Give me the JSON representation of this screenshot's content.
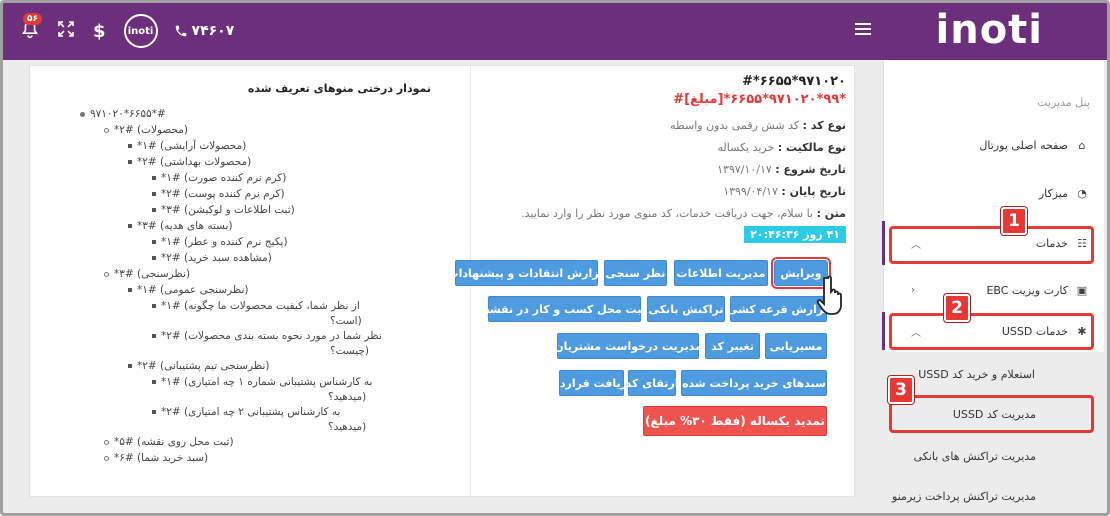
{
  "topbar": {
    "logo": "inoti",
    "badge": "۵۶",
    "currency": "$",
    "small_logo": "inoti",
    "phone": "۷۴۶۰۷"
  },
  "tree": {
    "title": "نمودار درختی منوهای تعریف شده",
    "rows": [
      "#*۶۶۵۵*۹۷۱۰۲۰",
      "(محصولات) #۲*",
      "(محصولات آرایشی) #۱*",
      "(محصولات بهداشتی) #۲*",
      "(کرم نرم کننده صورت) #۱*",
      "(کرم نرم کننده پوست) #۲*",
      "(ثبت اطلاعات و لوکیشن) #۳*",
      "(بسته های هدیه) #۳*",
      "(پکیج نرم کننده و عطر) #۱*",
      "(مشاهده سبد خرید) #۲*",
      "(نظرسنجی) #۳*",
      "(نظرسنجی عمومی) #۱*",
      "از نظر شما، کیفیت محصولات ما چگونه) #۱*",
      "(است؟",
      "نظر شما در مورد نحوه بسته بندی محصولات) #۲*",
      "(چیست؟",
      "(نظرسنجی تیم پشتیبانی) #۲*",
      "به کارشناس پشتیبانی شماره ۱ چه امتیازی) #۱*",
      "(میدهید؟",
      "به کارشناس پشتیبانی ۲ چه امتیازی) #۲*",
      "(میدهید؟",
      "(ثبت محل روی نقشه) #۵*",
      "(سبد خرید شما) #۶*"
    ]
  },
  "info": {
    "code": "#*۶۶۵۵*۹۷۱۰۲۰",
    "code_amount": "#[مبلغ]*۹۹*۹۷۱۰۲۰*۶۶۵۵*",
    "code_type_label": "نوع کد :",
    "code_type_value": "کد شش رقمی بدون واسطه",
    "ownership_label": "نوع مالکیت :",
    "ownership_value": "خرید یکساله",
    "start_label": "تاریخ شروع :",
    "start_value": "۱۳۹۷/۱۰/۱۷",
    "end_label": "تاریخ پایان :",
    "end_value": "۱۳۹۹/۰۴/۱۷",
    "text_label": "متن :",
    "text_value": "با سلام، جهت دریافت خدمات، کد منوی مورد نظر را وارد نمایید.",
    "countdown": "۴۱ روز ۲۰:۴۶:۳۶"
  },
  "buttons": {
    "edit": "ویرایش",
    "manage_info": "مدیریت اطلاعات",
    "survey": "نظر سنجی",
    "feedback_report": "گزارش انتقادات و پیشنهادات",
    "lottery_report": "گزارش قرعه کشی",
    "bank_tx": "تراکنش بانکی",
    "map_location": "ثبت محل کسب و کار در نقشه",
    "routing": "مسیریابی",
    "change_code": "تغییر کد",
    "subscriber_requests": "مدیریت درخواست مشتریان",
    "paid_baskets": "سبدهای خرید پرداخت شده",
    "upgrade_code": "ارتقای کد",
    "get_contract": "دریافت قرارداد",
    "renew": "تمدید یکساله (فقط ۳۰% مبلغ)"
  },
  "sidebar": {
    "panel_title": "پنل مدیریت",
    "home": "صفحه اصلی پورتال",
    "desk": "میزکار",
    "services": "خدمات",
    "ebc": "کارت ویزیت EBC",
    "ussd_services": "خدمات USSD",
    "ussd_inquiry": "استعلام و خرید کد USSD",
    "ussd_manage": "مدیریت کد USSD",
    "bank_tx_manage": "مدیریت تراکنش های بانکی",
    "sub_payment_manage": "مدیریت تراکنش پرداخت زیرمنو"
  },
  "markers": [
    "1",
    "2",
    "3"
  ],
  "colors": {
    "topbar": "#6b2f7c",
    "button": "#4f9be0",
    "renew": "#ef5350",
    "highlight": "#e53935",
    "countdown": "#2ecbe6"
  }
}
